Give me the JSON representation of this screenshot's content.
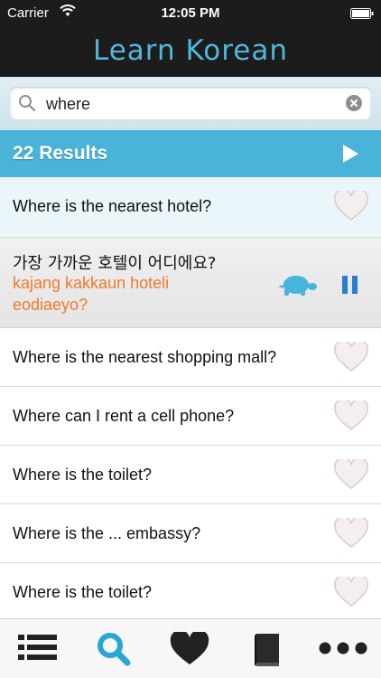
{
  "status": {
    "carrier": "Carrier",
    "time": "12:05 PM"
  },
  "header": {
    "title": "Learn Korean"
  },
  "search": {
    "value": "where",
    "placeholder": ""
  },
  "results": {
    "label": "22 Results"
  },
  "rows": [
    {
      "text": "Where is the nearest hotel?"
    },
    {
      "text": "Where is the nearest shopping mall?"
    },
    {
      "text": "Where can I rent a cell phone?"
    },
    {
      "text": "Where is the toilet?"
    },
    {
      "text": "Where is the ... embassy?"
    },
    {
      "text": "Where is the toilet?"
    }
  ],
  "expanded": {
    "korean": "가장 가까운 호텔이 어디에요?",
    "romanization": "kajang kakkaun hoteli eodiaeyo?"
  },
  "tabs": [
    {
      "icon": "list-icon"
    },
    {
      "icon": "search-icon"
    },
    {
      "icon": "heart-icon"
    },
    {
      "icon": "book-icon"
    },
    {
      "icon": "more-icon"
    }
  ],
  "colors": {
    "accent": "#4ab3d8",
    "title": "#4fb8dc",
    "romanization": "#f07a2b",
    "header_bg": "#1c1c1c"
  }
}
